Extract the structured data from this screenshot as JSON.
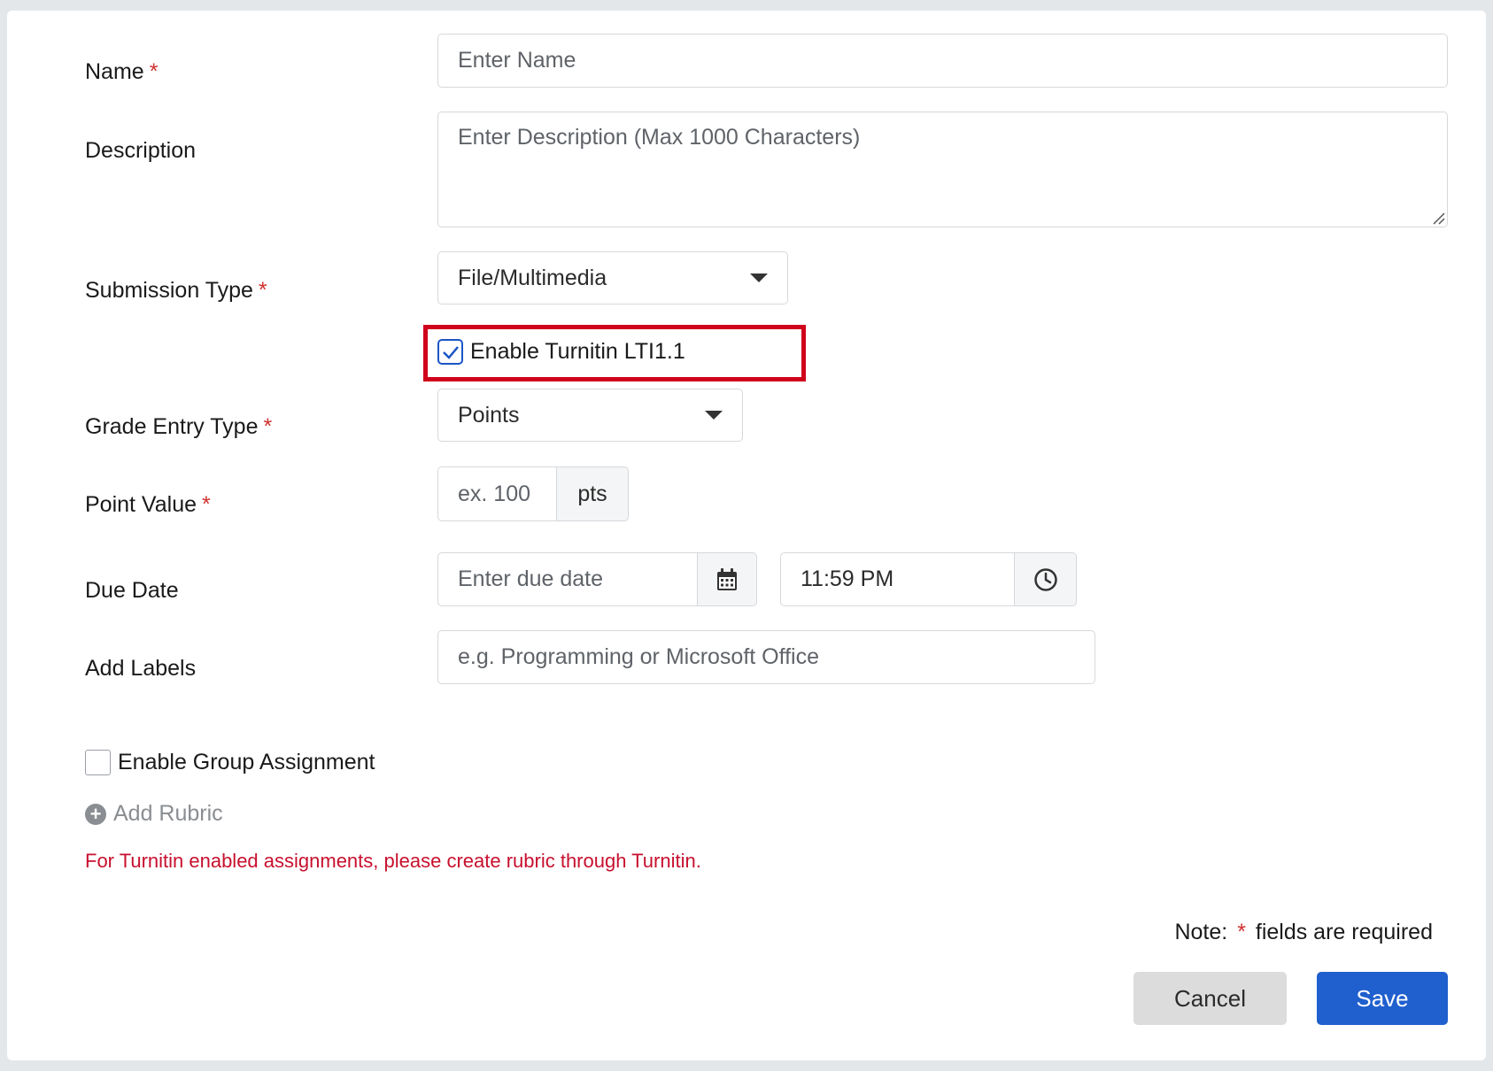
{
  "form": {
    "name": {
      "label": "Name",
      "required": "*",
      "placeholder": "Enter Name"
    },
    "description": {
      "label": "Description",
      "placeholder": "Enter Description (Max 1000 Characters)"
    },
    "submission_type": {
      "label": "Submission Type",
      "required": "*",
      "value": "File/Multimedia"
    },
    "turnitin": {
      "label": "Enable Turnitin LTI1.1",
      "checked": true
    },
    "grade_entry_type": {
      "label": "Grade Entry Type",
      "required": "*",
      "value": "Points"
    },
    "point_value": {
      "label": "Point Value",
      "required": "*",
      "placeholder": "ex. 100",
      "unit": "pts"
    },
    "due_date": {
      "label": "Due Date",
      "date_placeholder": "Enter due date",
      "time_value": "11:59 PM",
      "date_icon": "calendar-icon",
      "time_icon": "clock-icon"
    },
    "labels": {
      "label": "Add Labels",
      "placeholder": "e.g. Programming or Microsoft Office"
    },
    "group_assignment": {
      "label": "Enable Group Assignment",
      "checked": false
    },
    "add_rubric": {
      "label": "Add Rubric",
      "icon": "plus-circle-icon"
    },
    "turnitin_warning": "For Turnitin enabled assignments, please create rubric through Turnitin."
  },
  "footer": {
    "note_prefix": "Note:",
    "note_star": "*",
    "note_suffix": "fields are required",
    "cancel_label": "Cancel",
    "save_label": "Save"
  },
  "colors": {
    "required": "#d0312d",
    "primary": "#1f5fce",
    "highlight": "#d0021b",
    "warning": "#c8102e"
  }
}
